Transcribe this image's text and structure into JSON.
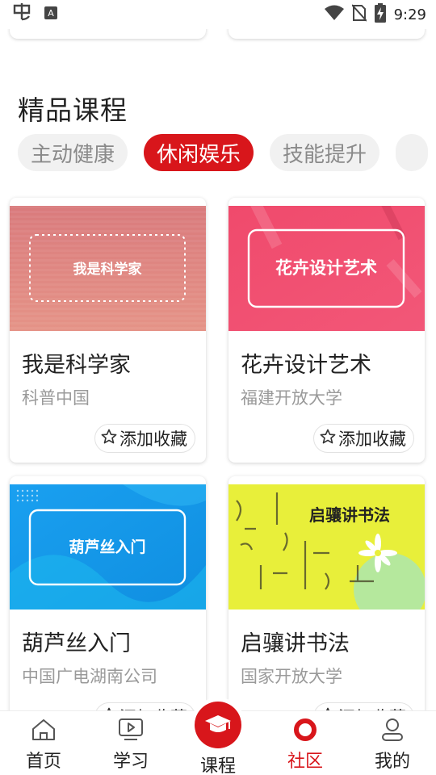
{
  "status_bar": {
    "time": "9:29",
    "left_icons": [
      "app-notification-icon",
      "text-input-icon"
    ],
    "right_icons": [
      "wifi-icon",
      "no-sim-icon",
      "battery-charging-icon"
    ]
  },
  "section": {
    "title": "精品课程",
    "tabs": [
      {
        "label": "主动健康",
        "active": false
      },
      {
        "label": "休闲娱乐",
        "active": true
      },
      {
        "label": "技能提升",
        "active": false
      },
      {
        "label": "",
        "active": false
      }
    ]
  },
  "courses": [
    {
      "title": "我是科学家",
      "provider": "科普中国",
      "banner_text": "我是科学家",
      "fav_label": "添加收藏"
    },
    {
      "title": "花卉设计艺术",
      "provider": "福建开放大学",
      "banner_text": "花卉设计艺术",
      "fav_label": "添加收藏"
    },
    {
      "title": "葫芦丝入门",
      "provider": "中国广电湖南公司",
      "banner_text": "葫芦丝入门",
      "fav_label": "添加收藏"
    },
    {
      "title": "启骧讲书法",
      "provider": "国家开放大学",
      "banner_text": "启骧讲书法",
      "fav_label": "添加收藏"
    }
  ],
  "bottom_nav": {
    "items": [
      {
        "label": "首页",
        "icon": "home-icon",
        "active": false
      },
      {
        "label": "学习",
        "icon": "video-icon",
        "active": false
      },
      {
        "label": "课程",
        "icon": "graduation-cap-icon",
        "active": false
      },
      {
        "label": "社区",
        "icon": "community-ring-icon",
        "active": true
      },
      {
        "label": "我的",
        "icon": "profile-icon",
        "active": false
      }
    ]
  },
  "colors": {
    "accent": "#d8161b",
    "tab_inactive_bg": "#f1f1f1",
    "secondary_text": "#9a9a9a"
  }
}
